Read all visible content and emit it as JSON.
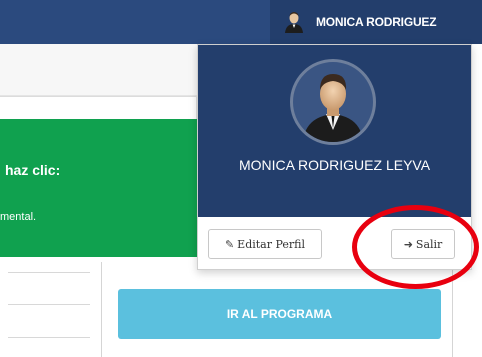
{
  "topbar": {
    "user_name": "MONICA RODRIGUEZ",
    "avatar_icon": "user-avatar-icon",
    "bg_color": "#2b4a7e"
  },
  "banner": {
    "title_partial": "haz clic:",
    "text_partial": "mental.",
    "color": "#10a14f"
  },
  "program_button": {
    "label": "IR AL PROGRAMA",
    "color": "#5bc0de"
  },
  "user_dropdown": {
    "full_name": "MONICA RODRIGUEZ LEYVA",
    "header_color": "#233e6c",
    "edit_profile_label": "Editar Perfil",
    "edit_icon": "edit-icon",
    "logout_label": "Salir",
    "logout_icon": "sign-out-icon"
  },
  "annotation": {
    "highlight_color": "#e8000f"
  }
}
